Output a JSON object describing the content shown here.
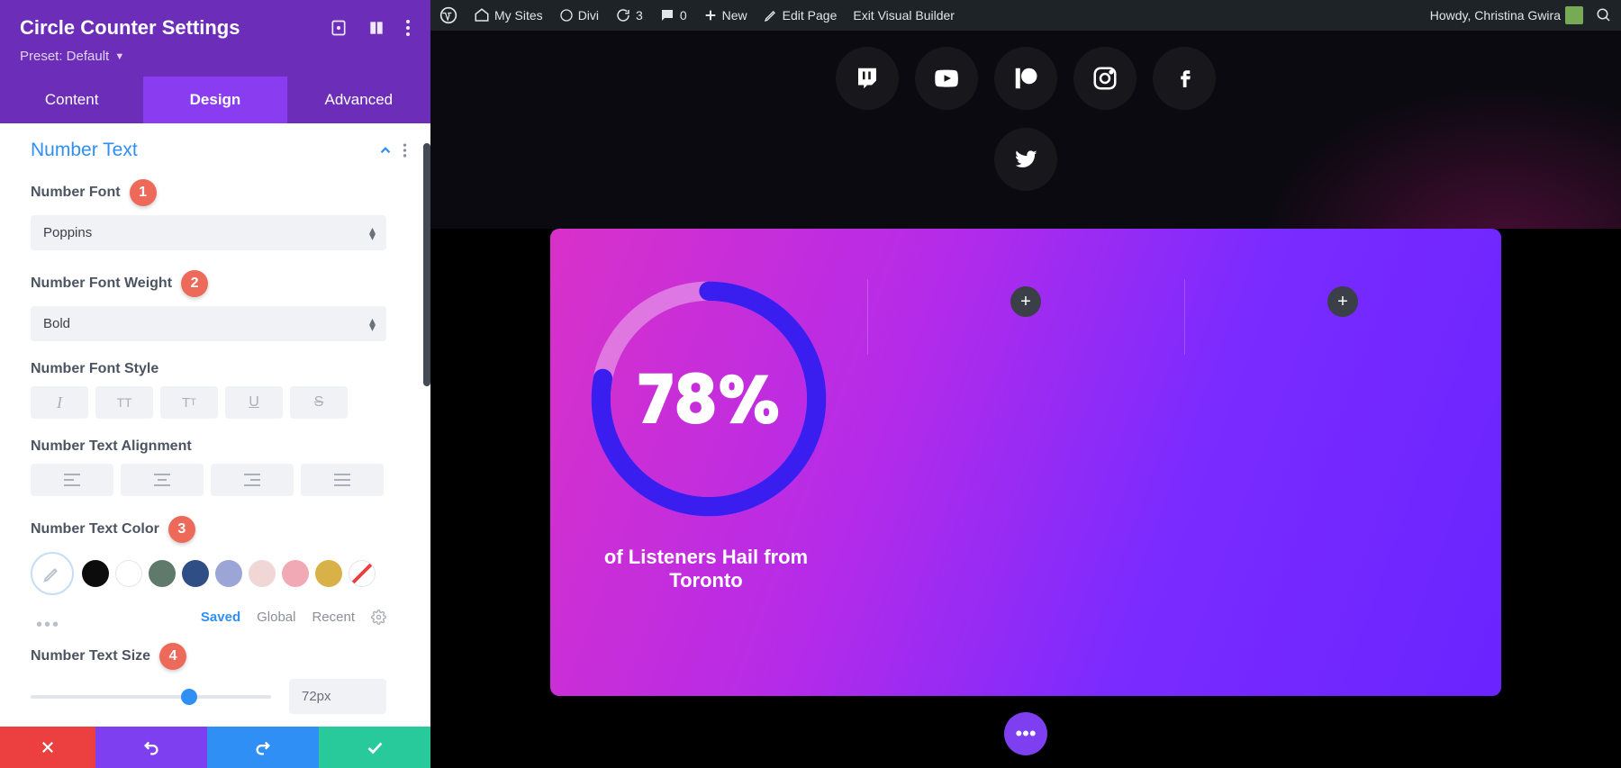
{
  "panel": {
    "title": "Circle Counter Settings",
    "preset_label": "Preset: Default",
    "tabs": {
      "content": "Content",
      "design": "Design",
      "advanced": "Advanced"
    }
  },
  "section": {
    "title": "Number Text"
  },
  "fields": {
    "font_label": "Number Font",
    "font_value": "Poppins",
    "weight_label": "Number Font Weight",
    "weight_value": "Bold",
    "style_label": "Number Font Style",
    "align_label": "Number Text Alignment",
    "color_label": "Number Text Color",
    "size_label": "Number Text Size",
    "size_value": "72px"
  },
  "badges": {
    "b1": "1",
    "b2": "2",
    "b3": "3",
    "b4": "4"
  },
  "color_tabs": {
    "saved": "Saved",
    "global": "Global",
    "recent": "Recent"
  },
  "swatches": [
    {
      "name": "black",
      "hex": "#0c0c0c"
    },
    {
      "name": "white",
      "hex": "#ffffff"
    },
    {
      "name": "olive",
      "hex": "#5f7a6a"
    },
    {
      "name": "navy",
      "hex": "#2f4e86"
    },
    {
      "name": "lav",
      "hex": "#9ba6d7"
    },
    {
      "name": "blush",
      "hex": "#f1d6d6"
    },
    {
      "name": "pink",
      "hex": "#f2a9b6"
    },
    {
      "name": "gold",
      "hex": "#d8b249"
    }
  ],
  "wp": {
    "my_sites": "My Sites",
    "divi": "Divi",
    "revs": "3",
    "comments": "0",
    "new_lbl": "New",
    "edit": "Edit Page",
    "exit": "Exit Visual Builder",
    "howdy": "Howdy, Christina Gwira"
  },
  "counter": {
    "percent": 78,
    "display": "78%",
    "caption": "of Listeners Hail from Toronto"
  },
  "plus": "+"
}
